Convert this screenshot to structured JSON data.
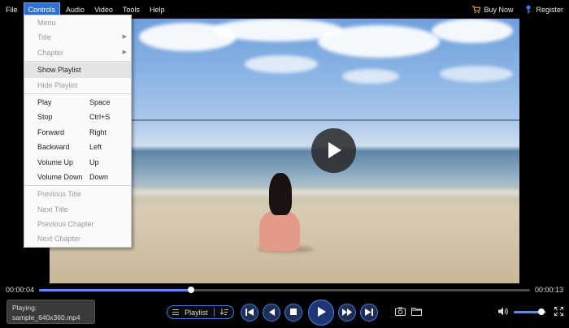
{
  "menubar": {
    "items": [
      {
        "label": "File"
      },
      {
        "label": "Controls"
      },
      {
        "label": "Audio"
      },
      {
        "label": "Video"
      },
      {
        "label": "Tools"
      },
      {
        "label": "Help"
      }
    ],
    "buy_now": "Buy Now",
    "register": "Register"
  },
  "controls_menu": {
    "header": "Menu",
    "title": "Title",
    "chapter": "Chapter",
    "show_playlist": "Show Playlist",
    "hide_playlist": "Hide Playlist",
    "play": {
      "label": "Play",
      "shortcut": "Space"
    },
    "stop": {
      "label": "Stop",
      "shortcut": "Ctrl+S"
    },
    "forward": {
      "label": "Forward",
      "shortcut": "Right"
    },
    "backward": {
      "label": "Backward",
      "shortcut": "Left"
    },
    "volume_up": {
      "label": "Volume Up",
      "shortcut": "Up"
    },
    "volume_down": {
      "label": "Volume Down",
      "shortcut": "Down"
    },
    "previous_title": "Previous Title",
    "next_title": "Next Title",
    "previous_chapter": "Previous Chapter",
    "next_chapter": "Next Chapter"
  },
  "player": {
    "current_time": "00:00:04",
    "total_time": "00:00:13",
    "progress_fraction": 0.31,
    "volume_fraction": 0.85,
    "now_playing_label": "Playing:",
    "now_playing_file": "sample_640x360.mp4",
    "playlist_label": "Playlist"
  },
  "colors": {
    "accent": "#2f6fd6",
    "progress": "#5b8ef0",
    "buy_now_icon": "#e8a33d",
    "register_icon": "#3e7de0"
  },
  "icons": [
    "cart-icon",
    "key-icon",
    "play-icon",
    "list-icon",
    "sort-icon",
    "previous-track-icon",
    "rewind-icon",
    "stop-icon",
    "fast-forward-icon",
    "next-track-icon",
    "snapshot-icon",
    "folder-icon",
    "volume-icon",
    "fullscreen-icon",
    "submenu-arrow-icon"
  ]
}
